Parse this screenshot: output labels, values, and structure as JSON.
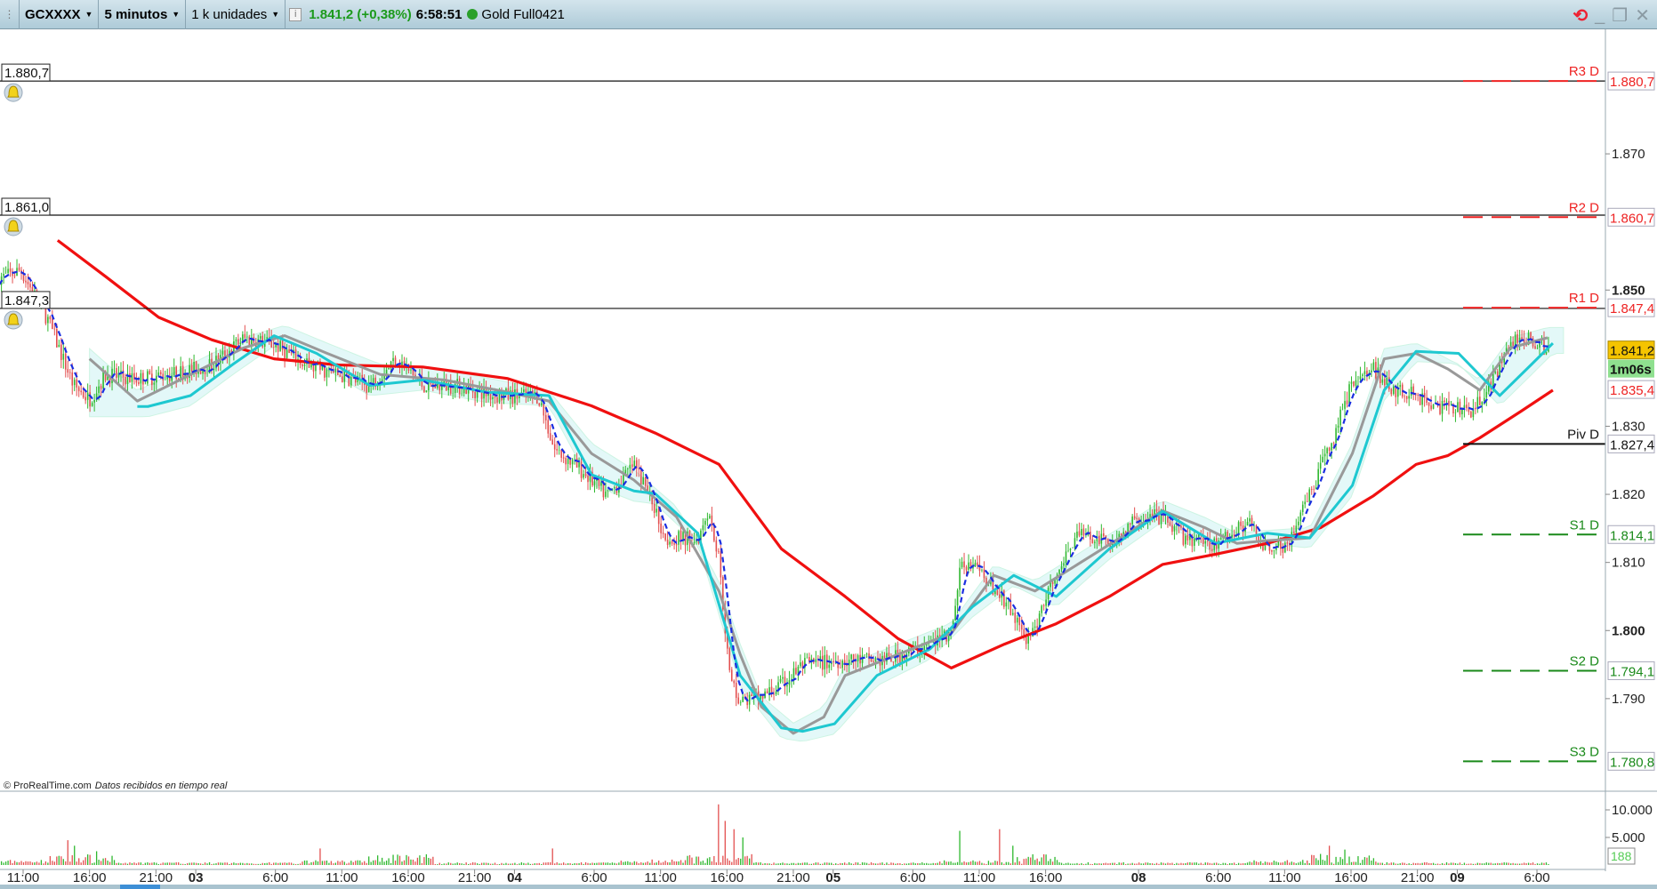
{
  "toolbar": {
    "instrument": "GCXXXX",
    "timeframe": "5 minutos",
    "units": "1 k unidades",
    "last_price": "1.841,2 (+0,38%)",
    "time": "6:58:51",
    "contract": "Gold Full0421"
  },
  "footer": {
    "copyright": "© ProRealTime.com",
    "status": "Datos recibidos en tiempo real"
  },
  "alerts": [
    {
      "label": "1.880,7",
      "price": 1880.7
    },
    {
      "label": "1.861,0",
      "price": 1861.0
    },
    {
      "label": "1.847,3",
      "price": 1847.3
    }
  ],
  "pivots": [
    {
      "name": "R3 D",
      "label": "1.880,7",
      "price": 1880.7,
      "color": "#ee2222"
    },
    {
      "name": "R2 D",
      "label": "1.860,7",
      "price": 1860.7,
      "color": "#ee2222"
    },
    {
      "name": "R1 D",
      "label": "1.847,4",
      "price": 1847.4,
      "color": "#ee2222"
    },
    {
      "name": "Piv D",
      "label": "1.827,4",
      "price": 1827.4,
      "color": "#111111"
    },
    {
      "name": "S1 D",
      "label": "1.814,1",
      "price": 1814.1,
      "color": "#1a8a1a"
    },
    {
      "name": "S2 D",
      "label": "1.794,1",
      "price": 1794.1,
      "color": "#1a8a1a"
    },
    {
      "name": "S3 D",
      "label": "1.780,8",
      "price": 1780.8,
      "color": "#1a8a1a"
    }
  ],
  "badges": {
    "current_price": "1.841,2",
    "current_price_value": 1841.2,
    "countdown": "1m06s",
    "red_level": "1.835,4",
    "red_level_value": 1835.4,
    "volume": "188"
  },
  "chart_data": {
    "type": "candlestick",
    "price_ticks": [
      {
        "label": "1.870",
        "v": 1870,
        "bold": false
      },
      {
        "label": "1.850",
        "v": 1850,
        "bold": true
      },
      {
        "label": "1.830",
        "v": 1830,
        "bold": false
      },
      {
        "label": "1.820",
        "v": 1820,
        "bold": false
      },
      {
        "label": "1.810",
        "v": 1810,
        "bold": false
      },
      {
        "label": "1.800",
        "v": 1800,
        "bold": true
      },
      {
        "label": "1.790",
        "v": 1790,
        "bold": false
      }
    ],
    "volume_ticks": [
      {
        "label": "10.000",
        "v": 10000
      },
      {
        "label": "5.000",
        "v": 5000
      }
    ],
    "time_ticks": [
      {
        "label": "11:00",
        "h": 0
      },
      {
        "label": "16:00",
        "h": 5
      },
      {
        "label": "21:00",
        "h": 10
      },
      {
        "label": "03",
        "h": 13,
        "bold": true
      },
      {
        "label": "6:00",
        "h": 19
      },
      {
        "label": "11:00",
        "h": 24
      },
      {
        "label": "16:00",
        "h": 29
      },
      {
        "label": "21:00",
        "h": 34
      },
      {
        "label": "04",
        "h": 37,
        "bold": true
      },
      {
        "label": "6:00",
        "h": 43
      },
      {
        "label": "11:00",
        "h": 48
      },
      {
        "label": "16:00",
        "h": 53
      },
      {
        "label": "21:00",
        "h": 58
      },
      {
        "label": "05",
        "h": 61,
        "bold": true
      },
      {
        "label": "6:00",
        "h": 67
      },
      {
        "label": "11:00",
        "h": 72
      },
      {
        "label": "16:00",
        "h": 77
      },
      {
        "label": "08",
        "h": 84,
        "bold": true
      },
      {
        "label": "6:00",
        "h": 90
      },
      {
        "label": "11:00",
        "h": 95
      },
      {
        "label": "16:00",
        "h": 100
      },
      {
        "label": "21:00",
        "h": 105
      },
      {
        "label": "09",
        "h": 108,
        "bold": true
      },
      {
        "label": "6:00",
        "h": 114
      }
    ],
    "close": [
      [
        -1.3,
        1852
      ],
      [
        -0.2,
        1853
      ],
      [
        1.8,
        1846
      ],
      [
        3.8,
        1836
      ],
      [
        5.0,
        1834
      ],
      [
        6.2,
        1837.6
      ],
      [
        8.6,
        1837
      ],
      [
        11,
        1837.6
      ],
      [
        14.2,
        1839
      ],
      [
        16.6,
        1843
      ],
      [
        19,
        1842
      ],
      [
        21.3,
        1839
      ],
      [
        23.7,
        1837.6
      ],
      [
        26.1,
        1836
      ],
      [
        28.1,
        1840
      ],
      [
        30.1,
        1836
      ],
      [
        32.5,
        1836
      ],
      [
        35.7,
        1834.5
      ],
      [
        38.8,
        1834.5
      ],
      [
        40,
        1826.7
      ],
      [
        42,
        1823.6
      ],
      [
        44,
        1819.8
      ],
      [
        46,
        1824.4
      ],
      [
        47.2,
        1819.8
      ],
      [
        48.4,
        1813.6
      ],
      [
        50.8,
        1813.6
      ],
      [
        51.6,
        1818
      ],
      [
        52.4,
        1810.5
      ],
      [
        53.2,
        1793.4
      ],
      [
        54,
        1789.5
      ],
      [
        55.6,
        1790.3
      ],
      [
        57.1,
        1791.9
      ],
      [
        58.7,
        1795
      ],
      [
        61.9,
        1795.7
      ],
      [
        65.1,
        1795.7
      ],
      [
        68.3,
        1798
      ],
      [
        69.9,
        1799.6
      ],
      [
        70.7,
        1810.5
      ],
      [
        72.3,
        1808.1
      ],
      [
        73.9,
        1804.3
      ],
      [
        75.8,
        1798
      ],
      [
        76.6,
        1802.7
      ],
      [
        77.8,
        1808.9
      ],
      [
        79.4,
        1814.3
      ],
      [
        81.8,
        1812.8
      ],
      [
        84.2,
        1816.7
      ],
      [
        85.8,
        1816.7
      ],
      [
        87.4,
        1813.6
      ],
      [
        89.8,
        1812.8
      ],
      [
        92.2,
        1815.9
      ],
      [
        93.7,
        1812
      ],
      [
        95.3,
        1812.8
      ],
      [
        96.9,
        1819.8
      ],
      [
        98.5,
        1827.5
      ],
      [
        100.1,
        1836.8
      ],
      [
        101.7,
        1838.4
      ],
      [
        103.3,
        1835.3
      ],
      [
        104.9,
        1834.5
      ],
      [
        106.5,
        1833
      ],
      [
        108.9,
        1832.2
      ],
      [
        110.5,
        1836
      ],
      [
        112,
        1842.2
      ],
      [
        113.6,
        1843
      ],
      [
        114.8,
        1841.2
      ]
    ],
    "series": [
      {
        "name": "sma-red",
        "color": "#f01010",
        "points": [
          [
            2.6,
            1857.3
          ],
          [
            6.2,
            1852
          ],
          [
            10.2,
            1846
          ],
          [
            14.2,
            1842.7
          ],
          [
            18.9,
            1839.9
          ],
          [
            23.7,
            1839
          ],
          [
            30.1,
            1838.7
          ],
          [
            36.5,
            1837
          ],
          [
            42.8,
            1833
          ],
          [
            47.6,
            1829
          ],
          [
            52.4,
            1824.4
          ],
          [
            57.1,
            1812
          ],
          [
            61.9,
            1805
          ],
          [
            65.9,
            1798.8
          ],
          [
            69.9,
            1794.5
          ],
          [
            73.9,
            1798
          ],
          [
            77.8,
            1801
          ],
          [
            81.8,
            1805
          ],
          [
            85.8,
            1809.7
          ],
          [
            89.8,
            1811.2
          ],
          [
            93.7,
            1812.8
          ],
          [
            97.7,
            1815.1
          ],
          [
            101.7,
            1819.8
          ],
          [
            104.9,
            1824.4
          ],
          [
            107.3,
            1825.7
          ],
          [
            109.7,
            1828.3
          ],
          [
            112.8,
            1832.2
          ],
          [
            115.2,
            1835.3
          ]
        ]
      },
      {
        "name": "gray-line",
        "color": "#999999",
        "points": [
          [
            5,
            1839.9
          ],
          [
            8.6,
            1833.7
          ],
          [
            11.8,
            1836.8
          ],
          [
            16.6,
            1841.5
          ],
          [
            19.7,
            1843.3
          ],
          [
            22.9,
            1840.7
          ],
          [
            26.9,
            1837.6
          ],
          [
            31.7,
            1836.8
          ],
          [
            36.5,
            1835
          ],
          [
            39.6,
            1833.7
          ],
          [
            42.8,
            1826
          ],
          [
            46,
            1822.1
          ],
          [
            49.2,
            1816.7
          ],
          [
            52.4,
            1805.8
          ],
          [
            54,
            1796.5
          ],
          [
            55.6,
            1788.8
          ],
          [
            58,
            1784.9
          ],
          [
            60.3,
            1787.3
          ],
          [
            61.9,
            1793.4
          ],
          [
            65.9,
            1796.5
          ],
          [
            69.9,
            1799.6
          ],
          [
            73.1,
            1808.1
          ],
          [
            76.2,
            1805.8
          ],
          [
            79.4,
            1809.7
          ],
          [
            82.6,
            1813.6
          ],
          [
            85.8,
            1817.6
          ],
          [
            89,
            1815.1
          ],
          [
            91.4,
            1812.8
          ],
          [
            93.7,
            1813.2
          ],
          [
            96.9,
            1813.6
          ],
          [
            100.1,
            1826
          ],
          [
            102.5,
            1839.9
          ],
          [
            104.9,
            1840.7
          ],
          [
            107.3,
            1838.4
          ],
          [
            109.7,
            1835.3
          ],
          [
            112,
            1841.5
          ],
          [
            114.8,
            1843
          ]
        ]
      },
      {
        "name": "cyan-line",
        "color": "#1ec8d0",
        "points": [
          [
            8.6,
            1832.9
          ],
          [
            9.4,
            1832.9
          ],
          [
            12.6,
            1834.5
          ],
          [
            15.8,
            1839.1
          ],
          [
            18.9,
            1843.3
          ],
          [
            22.1,
            1840.7
          ],
          [
            26.1,
            1836
          ],
          [
            30.1,
            1836.8
          ],
          [
            34.9,
            1835
          ],
          [
            39.6,
            1834.5
          ],
          [
            42.8,
            1822.9
          ],
          [
            46,
            1820.5
          ],
          [
            47.6,
            1820.1
          ],
          [
            50.8,
            1814.3
          ],
          [
            54,
            1793.4
          ],
          [
            57.1,
            1785.7
          ],
          [
            58.7,
            1785.2
          ],
          [
            61.1,
            1786.3
          ],
          [
            64.3,
            1793.4
          ],
          [
            68.3,
            1797.3
          ],
          [
            71.5,
            1803.5
          ],
          [
            74.6,
            1808.1
          ],
          [
            77.8,
            1805
          ],
          [
            81.8,
            1812
          ],
          [
            85.8,
            1817.5
          ],
          [
            89.8,
            1812.8
          ],
          [
            93.7,
            1814.3
          ],
          [
            96.9,
            1813.6
          ],
          [
            100.1,
            1821.3
          ],
          [
            102.5,
            1835.3
          ],
          [
            104.9,
            1841
          ],
          [
            108.1,
            1840.7
          ],
          [
            111.2,
            1834.5
          ],
          [
            113.6,
            1839.1
          ],
          [
            115.2,
            1842.2
          ]
        ]
      }
    ],
    "blue_dashed": {
      "name": "blue-dashed",
      "color": "#1a2ee0",
      "smoothing_bars": 5
    },
    "volume_spikes": [
      [
        3.4,
        4500
      ],
      [
        3.9,
        3500
      ],
      [
        5.6,
        2500
      ],
      [
        22.3,
        3000
      ],
      [
        39.8,
        3000
      ],
      [
        52.4,
        11000
      ],
      [
        52.9,
        8000
      ],
      [
        53.5,
        6500
      ],
      [
        54.2,
        5000
      ],
      [
        70.6,
        6200
      ],
      [
        73.6,
        6500
      ],
      [
        74.5,
        3500
      ],
      [
        98.3,
        3500
      ],
      [
        99.6,
        2800
      ]
    ]
  }
}
